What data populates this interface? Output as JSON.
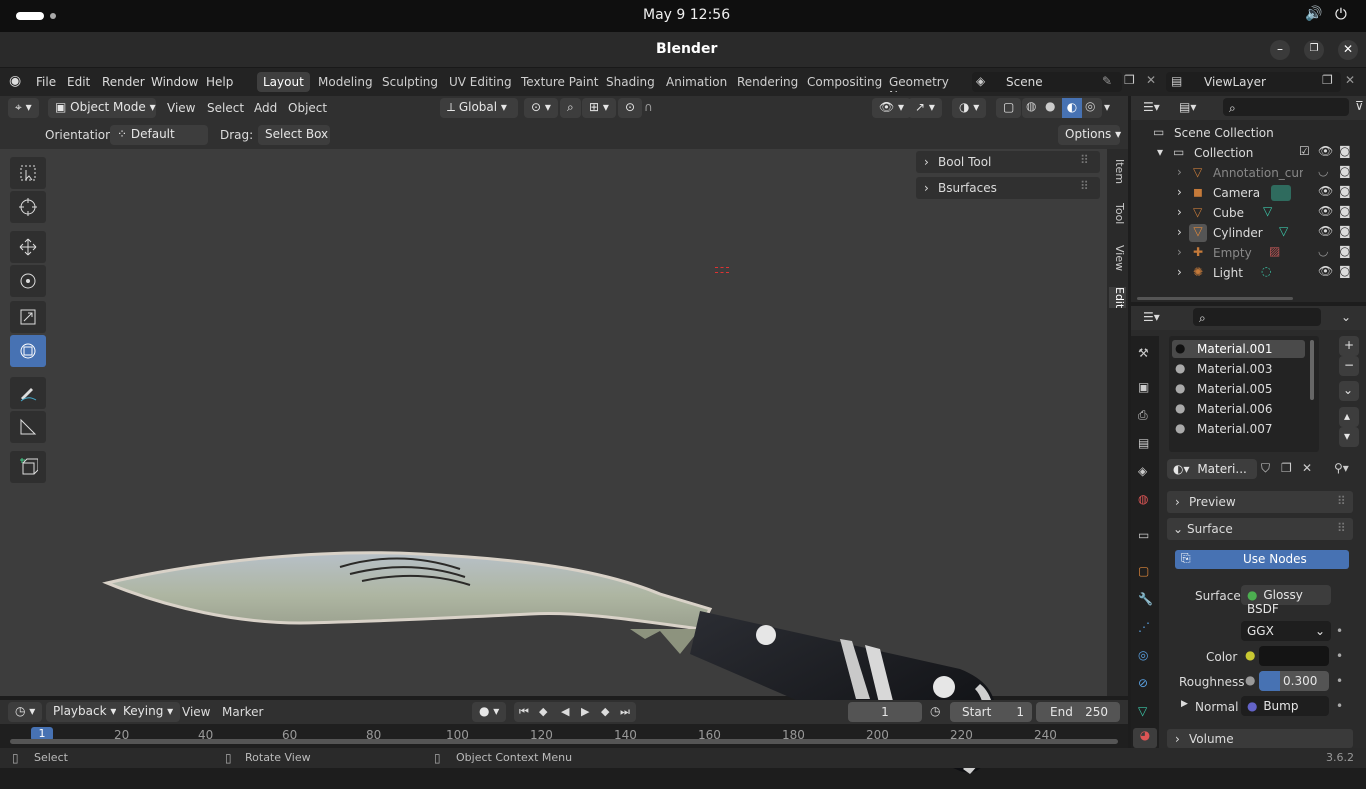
{
  "system": {
    "datetime": "May 9  12:56"
  },
  "window": {
    "title": "Blender"
  },
  "menu": {
    "file": "File",
    "edit": "Edit",
    "render": "Render",
    "window": "Window",
    "help": "Help"
  },
  "workspaces": [
    "Layout",
    "Modeling",
    "Sculpting",
    "UV Editing",
    "Texture Paint",
    "Shading",
    "Animation",
    "Rendering",
    "Compositing",
    "Geometry Noc"
  ],
  "scene": {
    "name": "Scene",
    "view_layer": "ViewLayer"
  },
  "viewport_header": {
    "mode": "Object Mode",
    "view": "View",
    "select": "Select",
    "add": "Add",
    "object": "Object",
    "transform": "Global"
  },
  "tool_settings": {
    "orientation_label": "Orientation:",
    "orientation": "Default",
    "drag_label": "Drag:",
    "drag": "Select Box",
    "options": "Options"
  },
  "npanel": {
    "tabs": [
      "Item",
      "Tool",
      "View",
      "Edit"
    ],
    "panels": [
      "Bool Tool",
      "Bsurfaces"
    ]
  },
  "timeline": {
    "playback": "Playback",
    "keying": "Keying",
    "view": "View",
    "marker": "Marker",
    "current_frame": "1",
    "start_label": "Start",
    "start": "1",
    "end_label": "End",
    "end": "250",
    "ticks": [
      "1",
      "20",
      "40",
      "60",
      "80",
      "100",
      "120",
      "140",
      "160",
      "180",
      "200",
      "220",
      "240"
    ]
  },
  "status": {
    "select": "Select",
    "rotate": "Rotate View",
    "context": "Object Context Menu",
    "version": "3.6.2"
  },
  "outliner": {
    "root": "Scene Collection",
    "collection": "Collection",
    "items": [
      {
        "name": "Annotation_curv",
        "dim": true
      },
      {
        "name": "Camera",
        "dim": false
      },
      {
        "name": "Cube",
        "dim": false
      },
      {
        "name": "Cylinder",
        "dim": false
      },
      {
        "name": "Empty",
        "dim": true
      },
      {
        "name": "Light",
        "dim": false
      }
    ]
  },
  "materials": {
    "slots": [
      "Material.001",
      "Material.003",
      "Material.005",
      "Material.006",
      "Material.007"
    ],
    "active_name": "Materi...",
    "preview": "Preview",
    "surface_header": "Surface",
    "use_nodes": "Use Nodes",
    "surface_label": "Surface",
    "surface_value": "Glossy BSDF",
    "distribution": "GGX",
    "color_label": "Color",
    "roughness_label": "Roughness",
    "roughness": "0.300",
    "roughness_fraction": 0.3,
    "normal_label": "Normal",
    "normal_value": "Bump",
    "volume": "Volume"
  }
}
